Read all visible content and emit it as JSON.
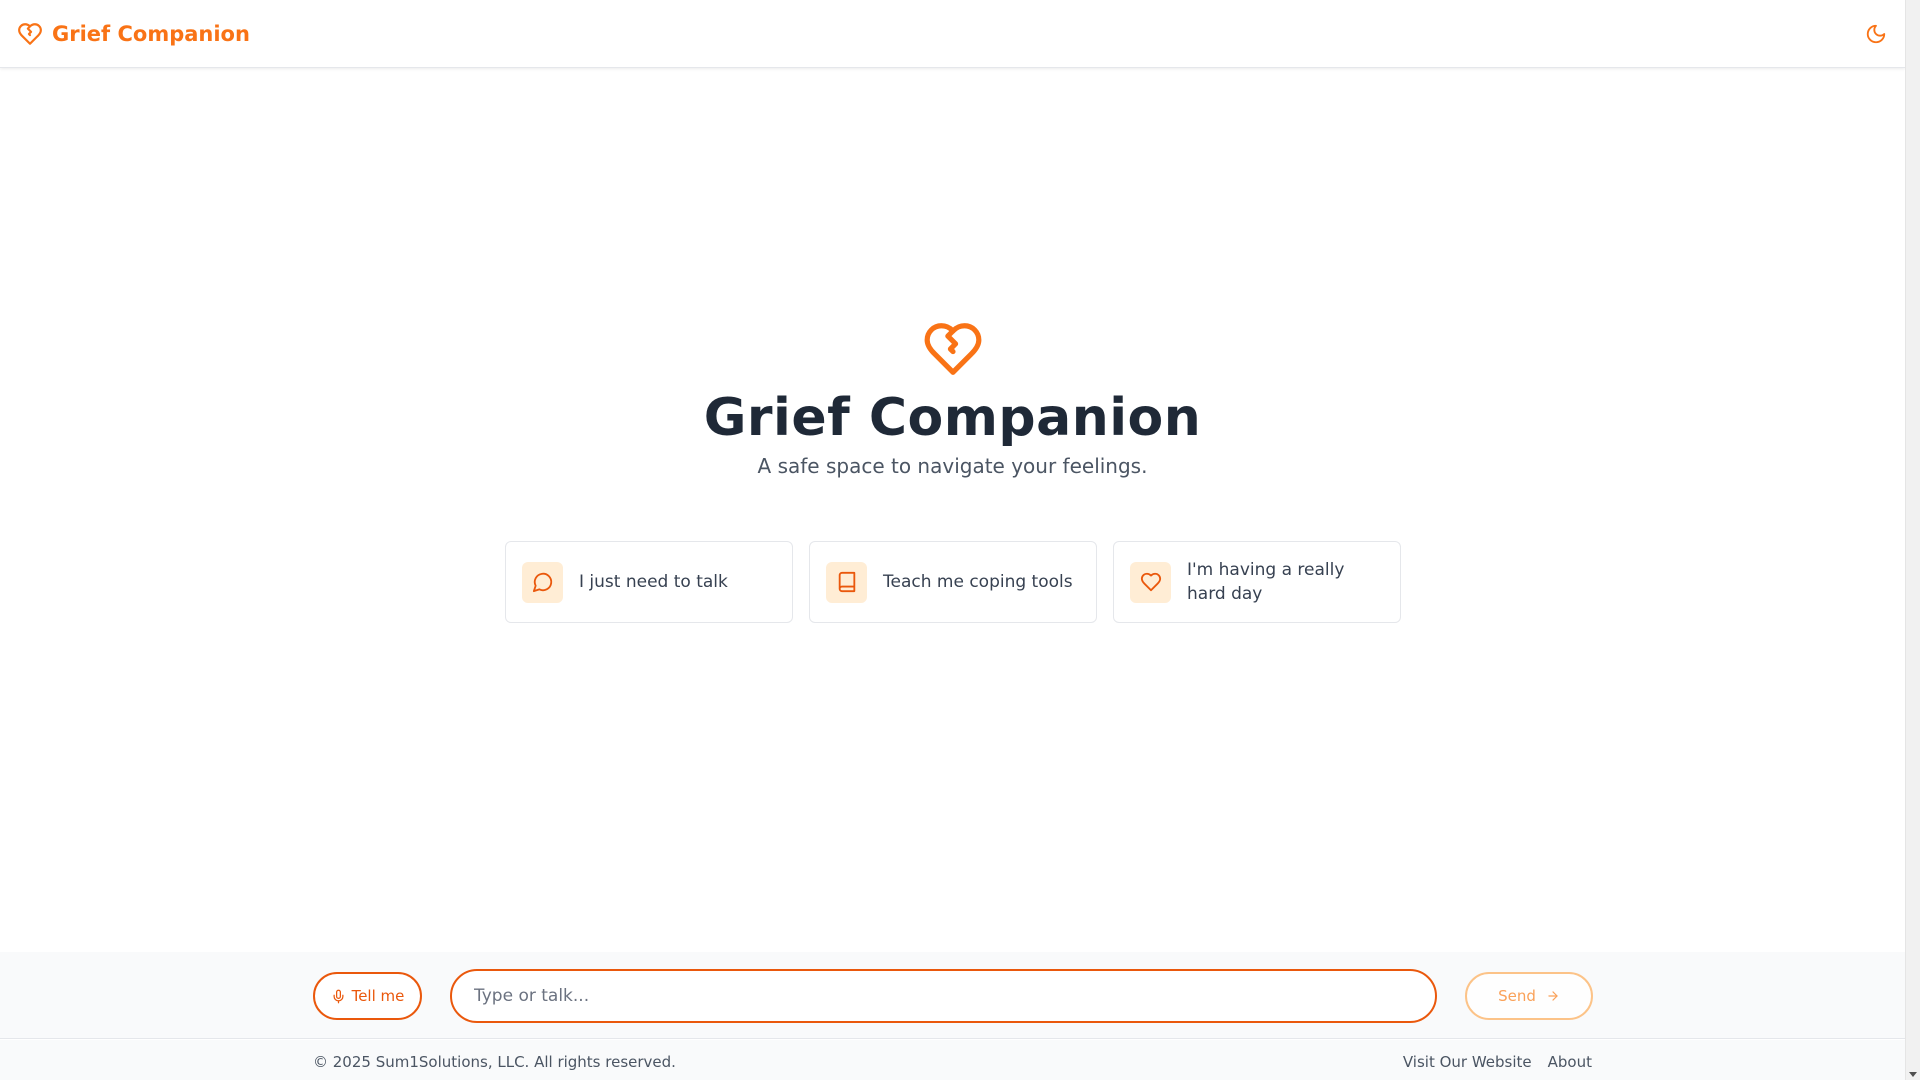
{
  "colors": {
    "accent": "#f97316",
    "accent_dark": "#ea580c",
    "accent_light_bg": "#ffedd5",
    "title": "#1f2937",
    "text_muted": "#4b5563"
  },
  "header": {
    "brand_name": "Grief Companion",
    "brand_icon": "heart-crack-icon",
    "theme_toggle_icon": "moon-icon"
  },
  "hero": {
    "icon": "heart-crack-icon",
    "title": "Grief Companion",
    "subtitle": "A safe space to navigate your feelings."
  },
  "cards": [
    {
      "icon": "message-circle-icon",
      "label": "I just need to talk"
    },
    {
      "icon": "book-icon",
      "label": "Teach me coping tools"
    },
    {
      "icon": "heart-icon",
      "label": "I'm having a really hard day"
    }
  ],
  "input_bar": {
    "tell_me_label": "Tell me",
    "tell_me_icon": "microphone-icon",
    "input_placeholder": "Type or talk...",
    "input_value": "",
    "send_label": "Send",
    "send_icon": "arrow-right-icon"
  },
  "footer": {
    "copyright": "© 2025 Sum1Solutions, LLC. All rights reserved.",
    "links": [
      "Visit Our Website",
      "About"
    ]
  }
}
